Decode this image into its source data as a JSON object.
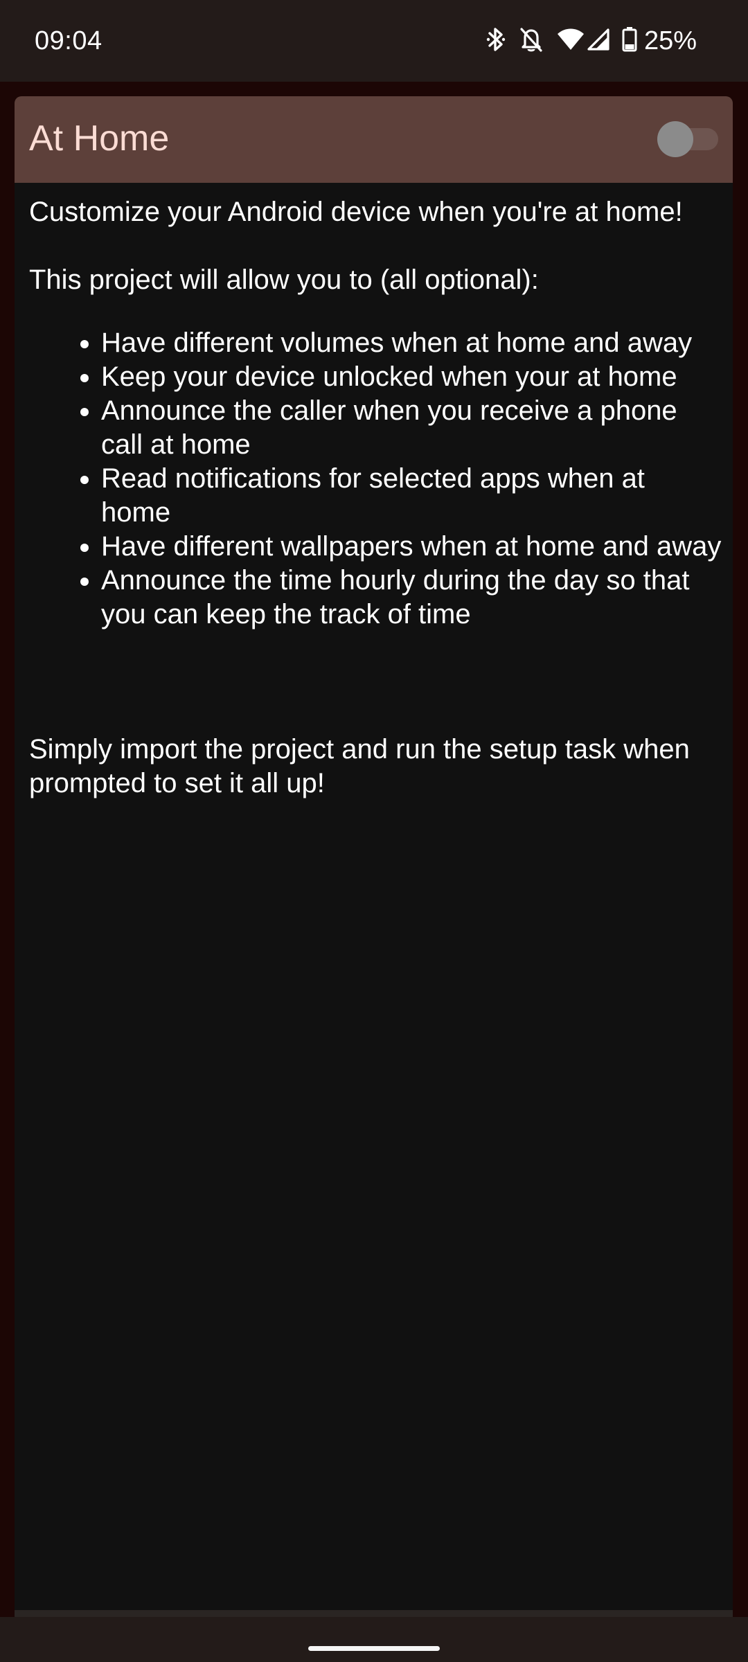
{
  "status_bar": {
    "time": "09:04",
    "battery_percent": "25%",
    "icons": [
      "bluetooth-icon",
      "notifications-off-icon",
      "wifi-icon",
      "cell-signal-icon",
      "battery-icon"
    ]
  },
  "card": {
    "title": "At Home",
    "toggle_on": false,
    "intro": "Customize your Android device when you're at home!",
    "lead": "This project will allow you to (all optional):",
    "features": [
      "Have different volumes when at home and away",
      "Keep your device unlocked when your at home",
      "Announce the caller when you receive a phone call at home",
      "Read notifications for selected apps when at home",
      "Have different wallpapers when at home and away",
      "Announce the time hourly during the day so that you can keep the track of time"
    ],
    "outro": "Simply import the project and run the setup task when prompted to set it all up!"
  },
  "colors": {
    "header_bg": "#5d403a",
    "title_color": "#fbdcd4",
    "body_bg": "#111111",
    "page_bg": "#1c0605",
    "system_bar_bg": "#231b19"
  }
}
